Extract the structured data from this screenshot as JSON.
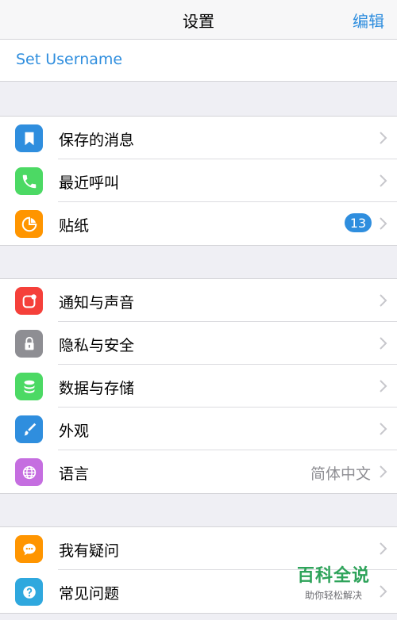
{
  "nav": {
    "title": "设置",
    "edit": "编辑"
  },
  "username": "Set Username",
  "groups": [
    {
      "items": [
        {
          "label": "保存的消息",
          "color": "#2f8ede",
          "icon": "bookmark-icon"
        },
        {
          "label": "最近呼叫",
          "color": "#4cd964",
          "icon": "phone-icon"
        },
        {
          "label": "贴纸",
          "color": "#ff9500",
          "icon": "sticker-icon",
          "badge": "13"
        }
      ]
    },
    {
      "items": [
        {
          "label": "通知与声音",
          "color": "#f5403a",
          "icon": "notification-icon"
        },
        {
          "label": "隐私与安全",
          "color": "#8e8e93",
          "icon": "lock-icon"
        },
        {
          "label": "数据与存储",
          "color": "#4cd964",
          "icon": "database-icon"
        },
        {
          "label": "外观",
          "color": "#2f8ede",
          "icon": "brush-icon"
        },
        {
          "label": "语言",
          "color": "#c56ee0",
          "icon": "globe-icon",
          "value": "简体中文"
        }
      ]
    },
    {
      "items": [
        {
          "label": "我有疑问",
          "color": "#ff9500",
          "icon": "chat-icon"
        },
        {
          "label": "常见问题",
          "color": "#2fa8de",
          "icon": "question-icon"
        }
      ]
    }
  ],
  "watermark": {
    "main": "百科全说",
    "sub": "助你轻松解决"
  }
}
